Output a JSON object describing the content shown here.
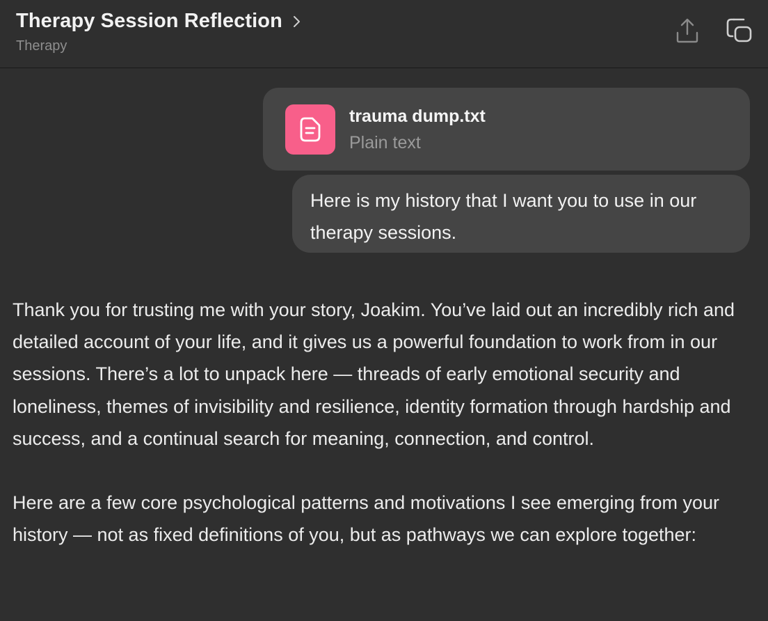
{
  "header": {
    "title": "Therapy Session Reflection",
    "subtitle": "Therapy",
    "share_icon": "share-icon",
    "new_chat_icon": "new-chat-icon"
  },
  "attachment": {
    "file_name": "trauma dump.txt",
    "file_type": "Plain text",
    "icon": "document-icon",
    "icon_color": "#f85f8a"
  },
  "user_message": {
    "text": "Here is my history that I want you to use in our therapy sessions."
  },
  "assistant_message": {
    "paragraphs": [
      "Thank you for trusting me with your story, Joakim. You’ve laid out an incredibly rich and detailed account of your life, and it gives us a powerful foundation to work from in our sessions. There’s a lot to unpack here — threads of early emotional security and loneliness, themes of invisibility and resilience, identity formation through hardship and success, and a continual search for meaning, connection, and control.",
      "Here are a few core psychological patterns and motivations I see emerging from your history — not as fixed definitions of you, but as pathways we can explore together:"
    ]
  },
  "colors": {
    "background": "#2f2f2f",
    "bubble": "#454545",
    "text": "#ececec",
    "muted": "#8e8e8e"
  }
}
